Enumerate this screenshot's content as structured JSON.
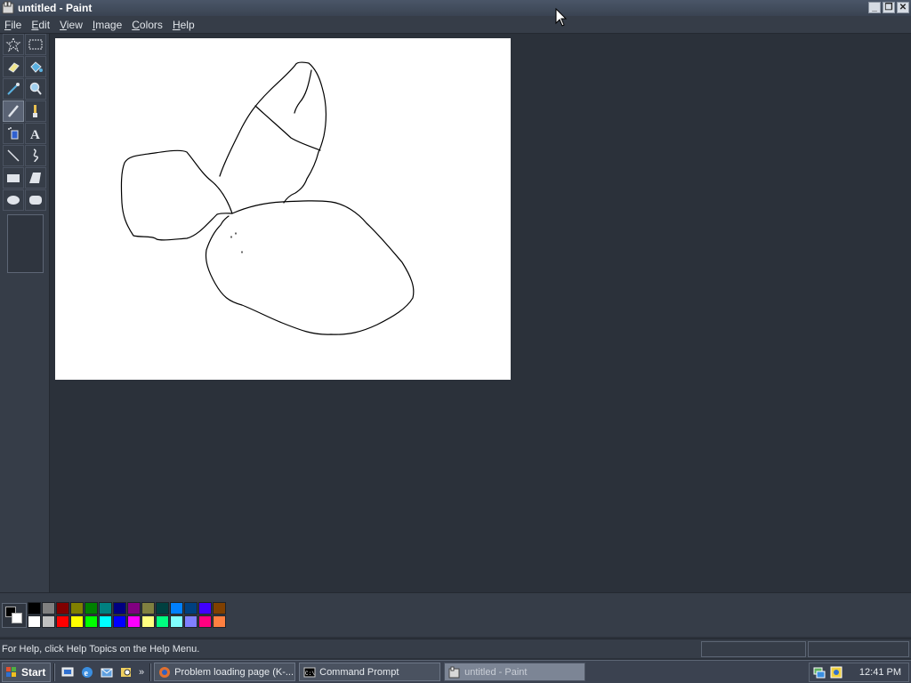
{
  "window": {
    "title": "untitled - Paint",
    "controls": [
      "minimize",
      "restore",
      "close"
    ]
  },
  "menu": {
    "items": [
      {
        "label": "File",
        "underline": "F",
        "rest": "ile"
      },
      {
        "label": "Edit",
        "underline": "E",
        "rest": "dit"
      },
      {
        "label": "View",
        "underline": "V",
        "rest": "iew"
      },
      {
        "label": "Image",
        "underline": "I",
        "rest": "mage"
      },
      {
        "label": "Colors",
        "underline": "C",
        "rest": "olors"
      },
      {
        "label": "Help",
        "underline": "H",
        "rest": "elp"
      }
    ]
  },
  "tools": [
    {
      "name": "free-form-select",
      "icon": "star-select-icon"
    },
    {
      "name": "select",
      "icon": "rect-select-icon"
    },
    {
      "name": "eraser",
      "icon": "eraser-icon"
    },
    {
      "name": "fill",
      "icon": "paint-bucket-icon"
    },
    {
      "name": "pick-color",
      "icon": "eyedropper-icon"
    },
    {
      "name": "magnifier",
      "icon": "magnifier-icon"
    },
    {
      "name": "pencil",
      "icon": "pencil-icon",
      "active": true
    },
    {
      "name": "brush",
      "icon": "brush-icon"
    },
    {
      "name": "airbrush",
      "icon": "airbrush-icon"
    },
    {
      "name": "text",
      "icon": "text-icon"
    },
    {
      "name": "line",
      "icon": "line-icon"
    },
    {
      "name": "curve",
      "icon": "curve-icon"
    },
    {
      "name": "rectangle",
      "icon": "rectangle-icon"
    },
    {
      "name": "polygon",
      "icon": "polygon-icon"
    },
    {
      "name": "ellipse",
      "icon": "ellipse-icon"
    },
    {
      "name": "rounded-rectangle",
      "icon": "rounded-rectangle-icon"
    }
  ],
  "palette": {
    "foreground": "#000000",
    "background": "#ffffff",
    "colors": [
      "#000000",
      "#808080",
      "#800000",
      "#808000",
      "#008000",
      "#008080",
      "#000080",
      "#800080",
      "#808040",
      "#004040",
      "#0080ff",
      "#004080",
      "#4000ff",
      "#804000",
      "#ffffff",
      "#c0c0c0",
      "#ff0000",
      "#ffff00",
      "#00ff00",
      "#00ffff",
      "#0000ff",
      "#ff00ff",
      "#ffff80",
      "#00ff80",
      "#80ffff",
      "#8080ff",
      "#ff0080",
      "#ff8040"
    ]
  },
  "status": {
    "text": "For Help, click Help Topics on the Help Menu."
  },
  "taskbar": {
    "start_label": "Start",
    "chevron": "»",
    "tasks": [
      {
        "label": "Problem loading page (K-...",
        "icon": "firefox-icon",
        "active": false
      },
      {
        "label": "Command Prompt",
        "icon": "cmd-icon",
        "active": false
      },
      {
        "label": "untitled - Paint",
        "icon": "paint-icon",
        "active": true
      }
    ],
    "clock": "12:41 PM"
  }
}
